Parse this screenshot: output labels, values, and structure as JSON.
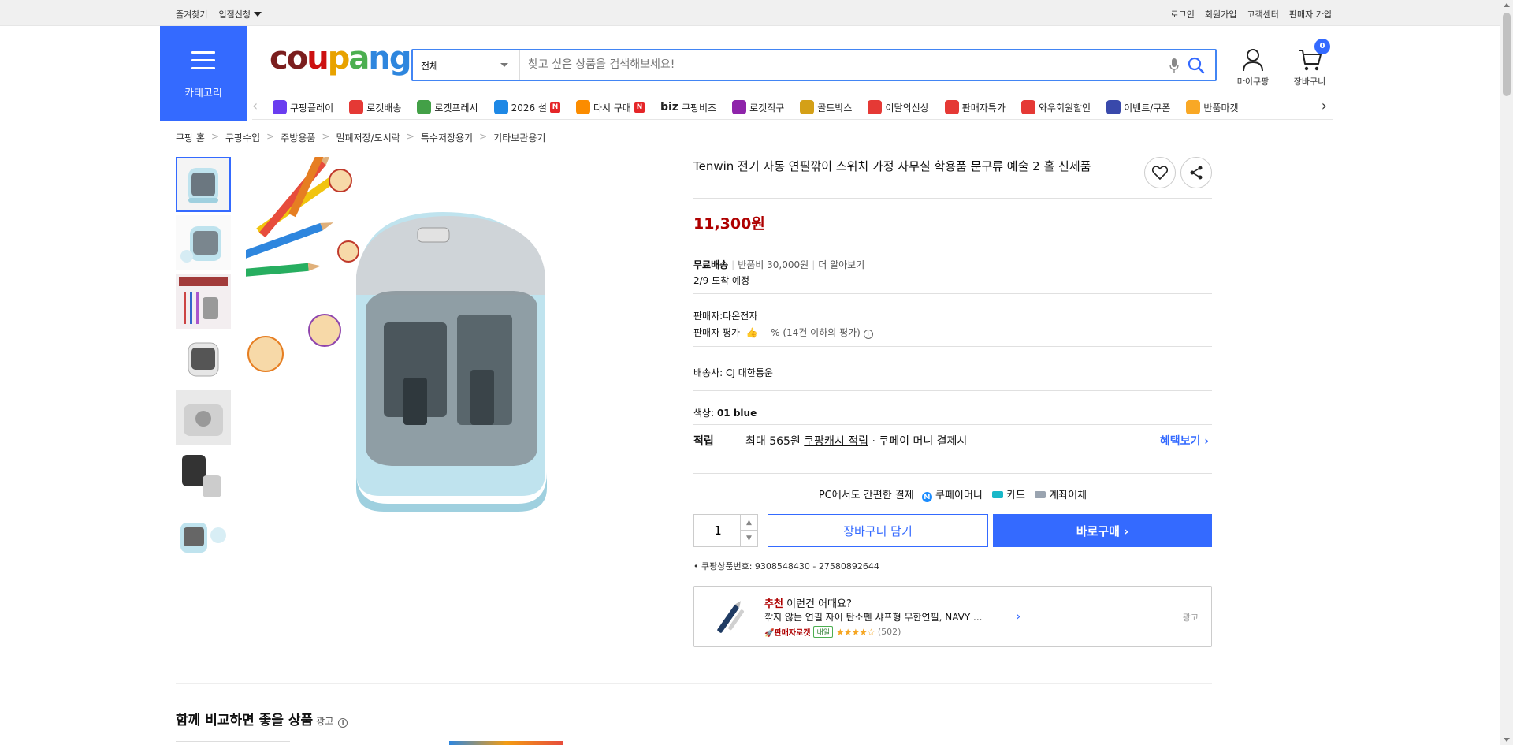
{
  "topbar": {
    "left": [
      "즐겨찾기",
      "입점신청"
    ],
    "right": [
      "로그인",
      "회원가입",
      "고객센터",
      "판매자 가입"
    ]
  },
  "header": {
    "category_label": "카테고리",
    "logo": [
      "c",
      "o",
      "u",
      "p",
      "a",
      "n",
      "g"
    ],
    "search_scope": "전체",
    "search_placeholder": "찾고 싶은 상품을 검색해보세요!",
    "mypage_label": "마이쿠팡",
    "cart_label": "장바구니",
    "cart_count": "0"
  },
  "catnav": [
    {
      "label": "쿠팡플레이",
      "icon": "play-icon",
      "color": "#6a3df0"
    },
    {
      "label": "로켓배송",
      "icon": "rocket-icon",
      "color": "#e53935"
    },
    {
      "label": "로켓프레시",
      "icon": "rocket-fresh-icon",
      "color": "#43a047"
    },
    {
      "label": "2026 설",
      "icon": "gift-icon",
      "color": "#1e88e5",
      "badge": "N"
    },
    {
      "label": "다시 구매",
      "icon": "home-icon",
      "color": "#fb8c00",
      "badge": "N"
    },
    {
      "label": "쿠팡비즈",
      "icon": "biz-icon",
      "color": "#333333",
      "prefix": "biz"
    },
    {
      "label": "로켓직구",
      "icon": "globe-icon",
      "color": "#8e24aa"
    },
    {
      "label": "골드박스",
      "icon": "goldbox-icon",
      "color": "#d4a017"
    },
    {
      "label": "이달의신상",
      "icon": "new-icon",
      "color": "#e53935"
    },
    {
      "label": "판매자특가",
      "icon": "percent-icon",
      "color": "#e53935"
    },
    {
      "label": "와우회원할인",
      "icon": "wow-icon",
      "color": "#e53935"
    },
    {
      "label": "이벤트/쿠폰",
      "icon": "coupon-icon",
      "color": "#3949ab"
    },
    {
      "label": "반품마켓",
      "icon": "market-icon",
      "color": "#f9a825"
    }
  ],
  "breadcrumb": [
    "쿠팡 홈",
    "쿠팡수입",
    "주방용품",
    "밀폐저장/도시락",
    "특수저장용기",
    "기타보관용기"
  ],
  "product": {
    "title": "Tenwin 전기 자동 연필깎이 스위치 가정 사무실 학용품 문구류 예술 2 홀 신제품",
    "price": "11,300원",
    "shipping_free": "무료배송",
    "return_fee": "반품비 30,000원",
    "more": "더 알아보기",
    "arrival": "2/9 도착 예정",
    "seller": "판매자:다온전자",
    "seller_rating_label": "판매자 평가",
    "seller_rating_value": "-- %",
    "seller_rating_note": "(14건 이하의 평가)",
    "courier_label": "배송사:",
    "courier": "CJ 대한통운",
    "color_label": "색상:",
    "color": "01 blue",
    "reward_label": "적립",
    "reward_prefix": "최대 565원",
    "reward_link": "쿠팡캐시 적립",
    "reward_suffix": "· 쿠페이 머니 결제시",
    "benefit": "혜택보기",
    "pay_title": "PC에서도 간편한 결제",
    "pay_methods": [
      "쿠페이머니",
      "카드",
      "계좌이체"
    ],
    "qty": "1",
    "cart_btn": "장바구니 담기",
    "buy_btn": "바로구매",
    "product_id": "쿠팡상품번호: 9308548430 - 27580892644",
    "accent": "#346aff",
    "price_color": "#ae0000"
  },
  "recommend": {
    "head_accent": "추천",
    "head_rest": "이런건 어때요?",
    "name": "깎지 않는 연필 자이 탄소펜 샤프형 무한연필, NAVY ...",
    "rocket": "판매자로켓",
    "badge": "내일",
    "stars": "★★★★☆",
    "reviews": "(502)",
    "ad": "광고"
  },
  "compare": {
    "title": "함께 비교하면 좋을 상품",
    "ad": "광고"
  }
}
